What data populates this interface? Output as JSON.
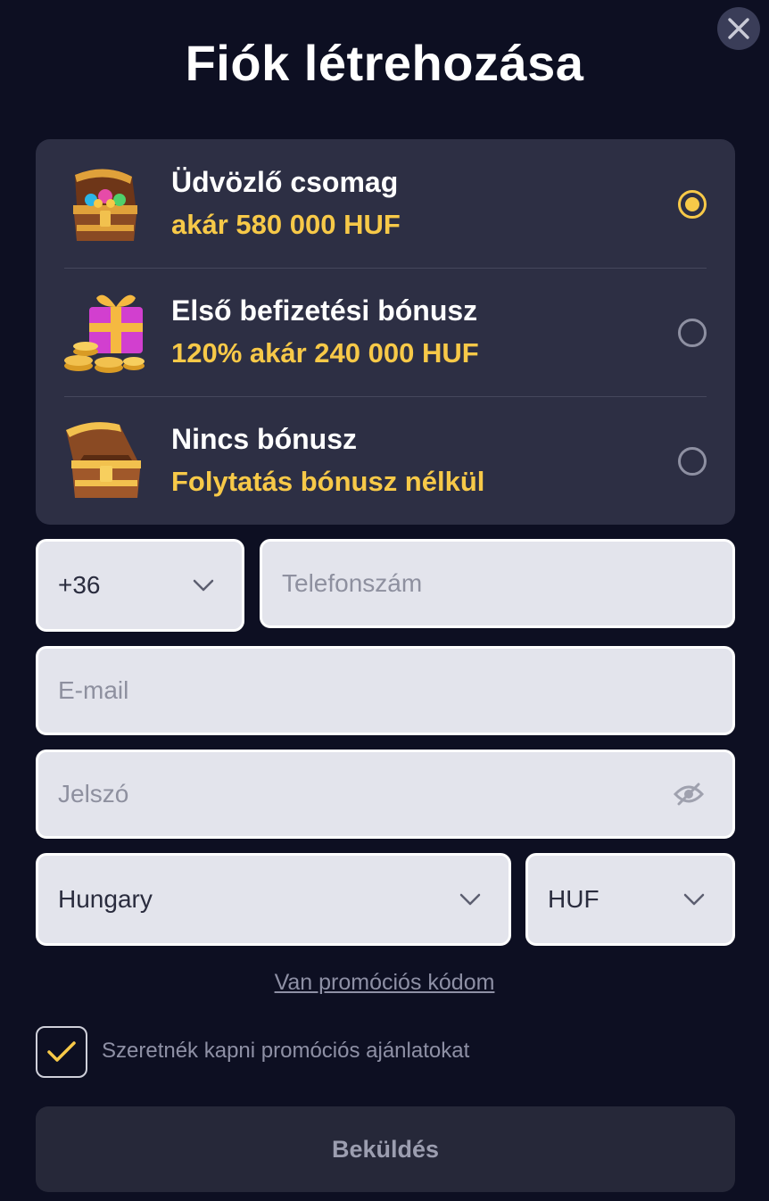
{
  "header": {
    "title": "Fiók létrehozása"
  },
  "bonuses": [
    {
      "title": "Üdvözlő csomag",
      "subtitle": "akár 580 000 HUF",
      "selected": true,
      "icon": "treasure-chest-gems-icon"
    },
    {
      "title": "Első befizetési bónusz",
      "subtitle": "120% akár 240 000 HUF",
      "selected": false,
      "icon": "gift-coins-icon"
    },
    {
      "title": "Nincs bónusz",
      "subtitle": "Folytatás bónusz nélkül",
      "selected": false,
      "icon": "empty-chest-icon"
    }
  ],
  "form": {
    "phone_code": "+36",
    "phone_placeholder": "Telefonszám",
    "email_placeholder": "E-mail",
    "password_placeholder": "Jelszó",
    "country": "Hungary",
    "currency": "HUF",
    "promo_link": "Van promóciós kódom",
    "promo_checkbox_label": "Szeretnék kapni promóciós ajánlatokat",
    "promo_checkbox_checked": true,
    "submit_label": "Beküldés"
  },
  "colors": {
    "background": "#0d0f22",
    "panel": "#2d2f44",
    "accent": "#f7c948",
    "field": "#e3e4ec"
  }
}
